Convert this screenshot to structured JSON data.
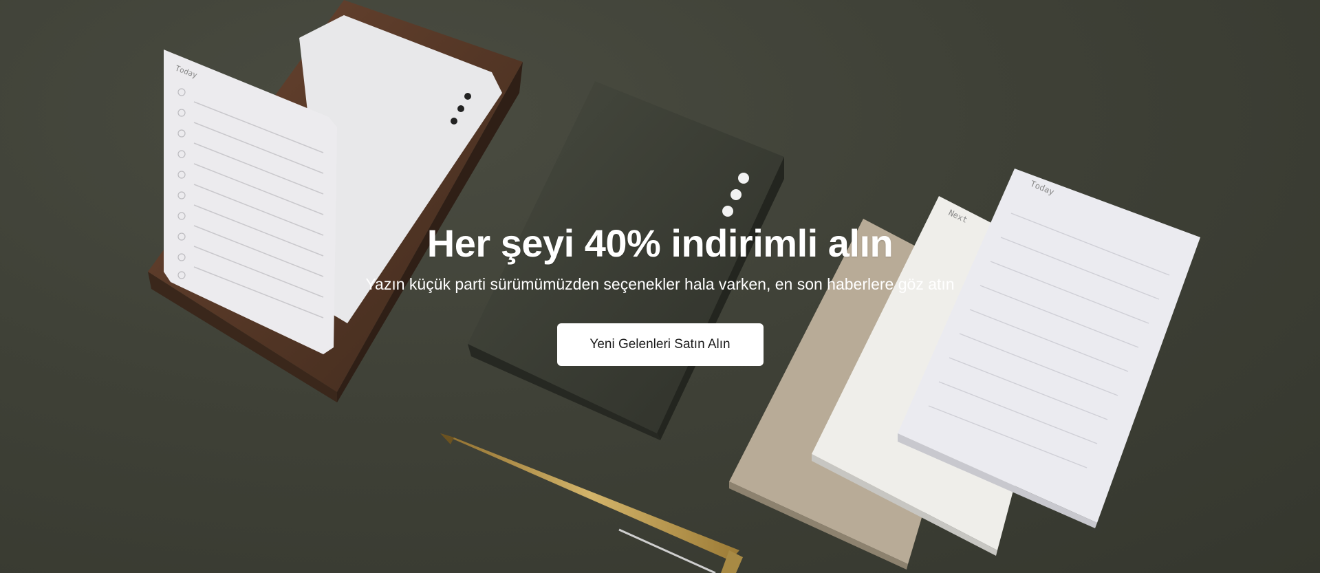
{
  "hero": {
    "headline": "Her şeyi 40% indirimli alın",
    "subheadline": "Yazın küçük parti sürümümüzden seçenekler hala varken, en son haberlere göz atın",
    "cta_label": "Yeni Gelenleri Satın Alın"
  },
  "image": {
    "card_labels": {
      "today": "Today",
      "next": "Next"
    }
  },
  "colors": {
    "background": "#3d3f35",
    "button_bg": "#ffffff",
    "button_text": "#1a1a1a",
    "text": "#ffffff"
  }
}
